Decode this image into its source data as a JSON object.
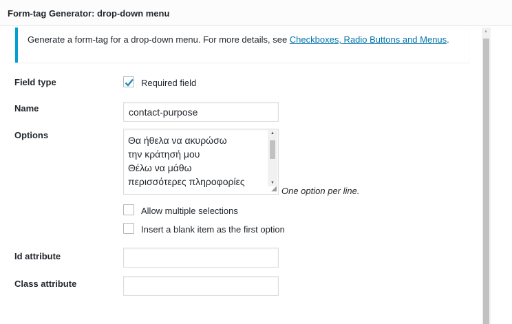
{
  "dialog": {
    "title": "Form-tag Generator: drop-down menu"
  },
  "notice": {
    "text": "Generate a form-tag for a drop-down menu. For more details, see ",
    "link_label": "Checkboxes, Radio Buttons and Menus",
    "suffix": "."
  },
  "field_type": {
    "label": "Field type",
    "required_label": "Required field",
    "required_checked": true
  },
  "name": {
    "label": "Name",
    "value": "contact-purpose"
  },
  "options": {
    "label": "Options",
    "lines": [
      "Θα ήθελα να ακυρώσω",
      "την κράτησή μου",
      "Θέλω να μάθω",
      "περισσότερες πληροφορίες"
    ],
    "hint": "One option per line.",
    "allow_multiple_label": "Allow multiple selections",
    "blank_first_label": "Insert a blank item as the first option"
  },
  "id_attr": {
    "label": "Id attribute",
    "value": ""
  },
  "class_attr": {
    "label": "Class attribute",
    "value": ""
  },
  "colors": {
    "accent": "#00a0d2",
    "link": "#0073aa",
    "check": "#1e8cbe"
  }
}
